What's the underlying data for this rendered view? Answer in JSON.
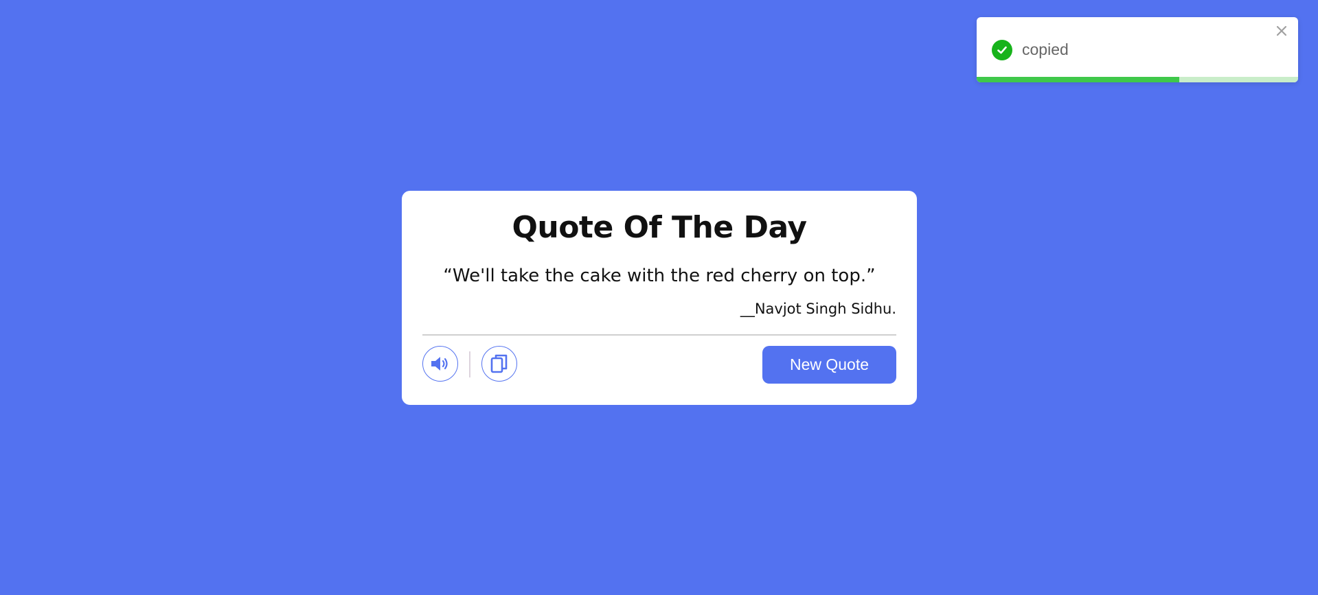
{
  "card": {
    "title": "Quote Of The Day",
    "quote": "“We'll take the cake with the red cherry on top.”",
    "author": "__Navjot Singh Sidhu.",
    "new_quote_label": "New Quote"
  },
  "icons": {
    "speech": "speaker-icon",
    "copy": "copy-icon",
    "toast_status": "check-circle-icon",
    "toast_close": "close-icon"
  },
  "toast": {
    "message": "copied",
    "progress": 0.63
  },
  "colors": {
    "background": "#5372F0",
    "accent": "#5372F0",
    "success": "#17b31b",
    "progress_fill": "#3fc84a",
    "progress_track": "#c9edc9"
  }
}
